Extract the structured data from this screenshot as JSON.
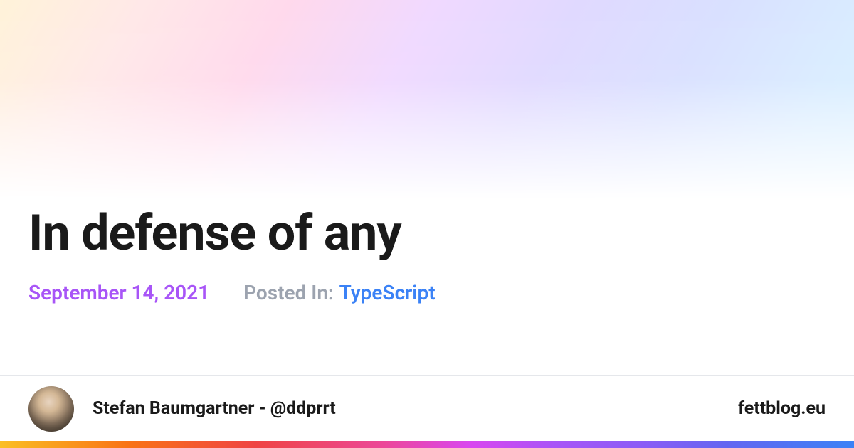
{
  "title": "In defense of any",
  "date": "September 14, 2021",
  "posted_in_label": "Posted In:",
  "category": "TypeScript",
  "author": {
    "name": "Stefan Baumgartner - @ddprrt"
  },
  "site": "fettblog.eu",
  "colors": {
    "date": "#a855f7",
    "category": "#3b82f6",
    "muted": "#9ca3af"
  }
}
